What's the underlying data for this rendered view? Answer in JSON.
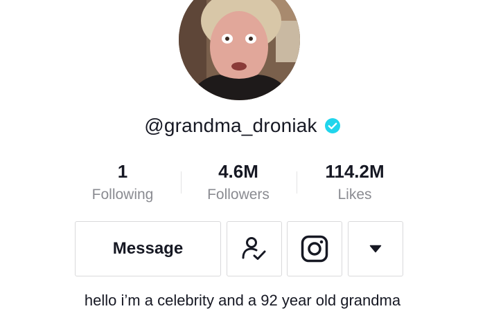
{
  "profile": {
    "username": "@grandma_droniak",
    "verified": true,
    "bio": "hello i’m a celebrity and a 92 year old grandma"
  },
  "stats": [
    {
      "value": "1",
      "label": "Following"
    },
    {
      "value": "4.6M",
      "label": "Followers"
    },
    {
      "value": "114.2M",
      "label": "Likes"
    }
  ],
  "actions": {
    "message_label": "Message",
    "friend_icon": "user-check-icon",
    "instagram_icon": "instagram-icon",
    "more_icon": "caret-down-icon"
  },
  "colors": {
    "text_primary": "#161823",
    "text_secondary": "#8a8b91",
    "border": "#d9d9db",
    "verified": "#20d5ec"
  }
}
